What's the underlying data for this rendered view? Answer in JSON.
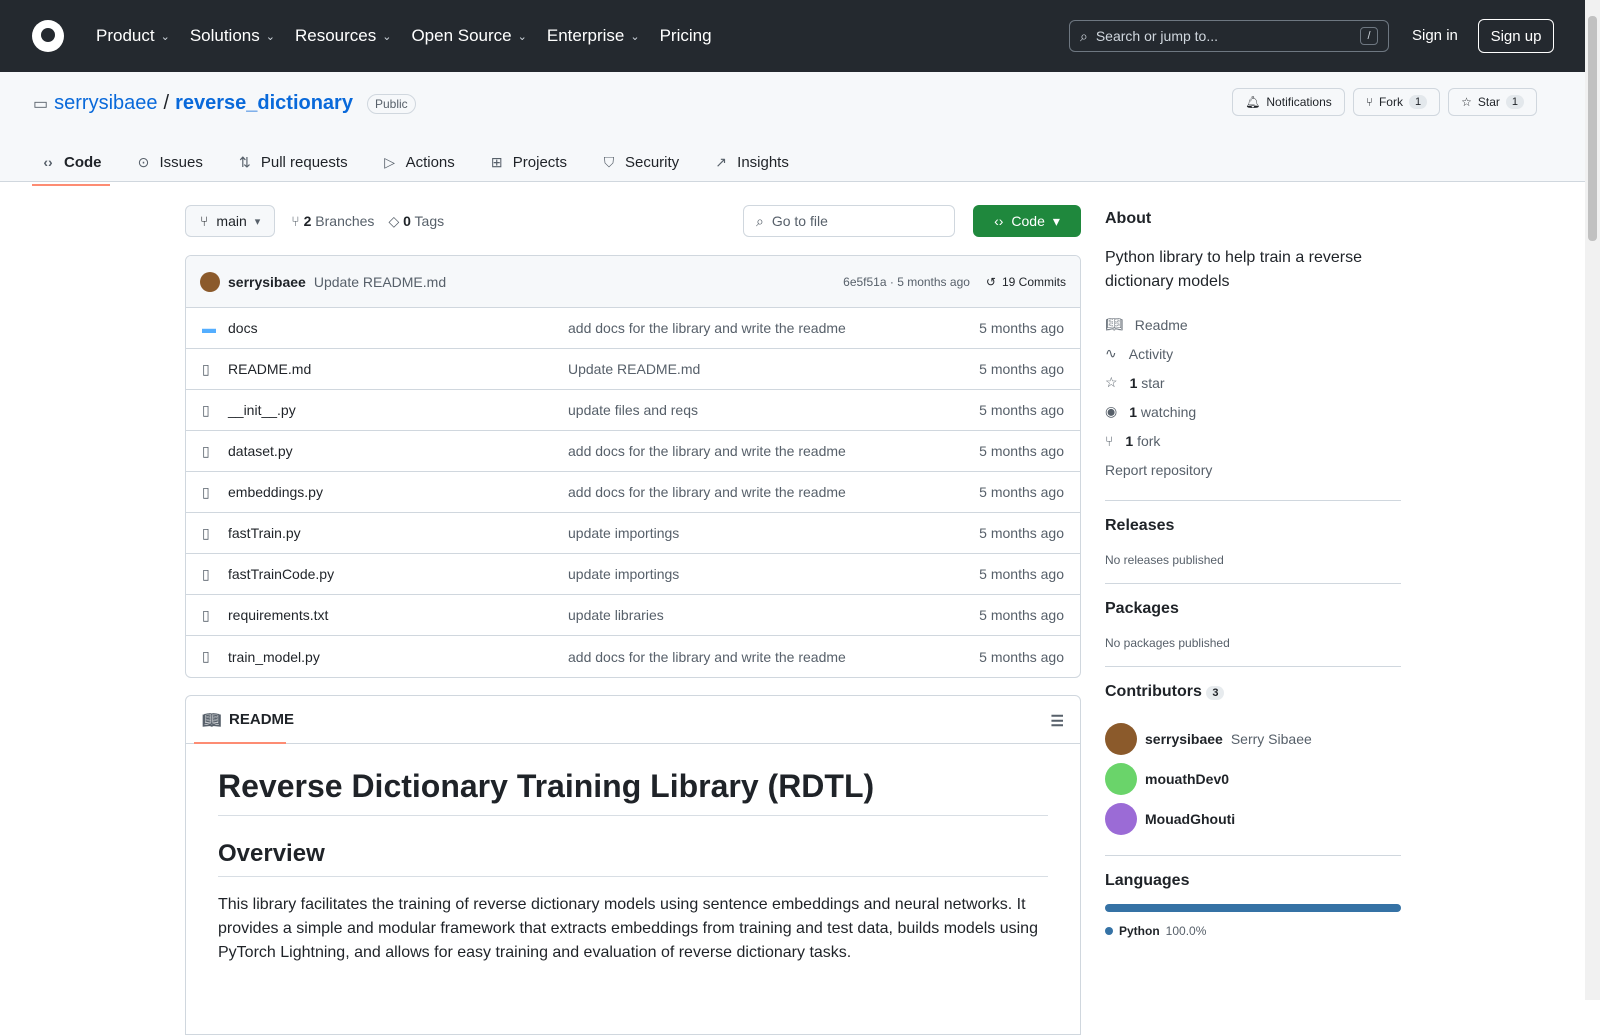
{
  "header": {
    "nav": [
      "Product",
      "Solutions",
      "Resources",
      "Open Source",
      "Enterprise",
      "Pricing"
    ],
    "search_placeholder": "Search or jump to...",
    "slash_key": "/",
    "sign_in": "Sign in",
    "sign_up": "Sign up"
  },
  "repo": {
    "owner": "serrysibaee",
    "separator": "/",
    "name": "reverse_dictionary",
    "visibility": "Public",
    "notifications": "Notifications",
    "fork_label": "Fork",
    "fork_count": "1",
    "star_label": "Star",
    "star_count": "1"
  },
  "tabs": [
    {
      "label": "Code",
      "icon": "code-icon"
    },
    {
      "label": "Issues",
      "icon": "issue-icon"
    },
    {
      "label": "Pull requests",
      "icon": "pull-request-icon"
    },
    {
      "label": "Actions",
      "icon": "play-icon"
    },
    {
      "label": "Projects",
      "icon": "table-icon"
    },
    {
      "label": "Security",
      "icon": "shield-icon"
    },
    {
      "label": "Insights",
      "icon": "graph-icon"
    }
  ],
  "toolbar": {
    "branch": "main",
    "branches_count": "2",
    "branches_label": "Branches",
    "tags_count": "0",
    "tags_label": "Tags",
    "goto_file": "Go to file",
    "code_button": "Code"
  },
  "latest_commit": {
    "author": "serrysibaee",
    "message": "Update README.md",
    "meta": "6e5f51a · 5 months ago",
    "commits": "19 Commits"
  },
  "files": [
    {
      "name": "docs",
      "type": "dir",
      "message": "add docs for the library and write the readme",
      "date": "5 months ago"
    },
    {
      "name": "README.md",
      "type": "file",
      "message": "Update README.md",
      "date": "5 months ago"
    },
    {
      "name": "__init__.py",
      "type": "file",
      "message": "update files and reqs",
      "date": "5 months ago"
    },
    {
      "name": "dataset.py",
      "type": "file",
      "message": "add docs for the library and write the readme",
      "date": "5 months ago"
    },
    {
      "name": "embeddings.py",
      "type": "file",
      "message": "add docs for the library and write the readme",
      "date": "5 months ago"
    },
    {
      "name": "fastTrain.py",
      "type": "file",
      "message": "update importings",
      "date": "5 months ago"
    },
    {
      "name": "fastTrainCode.py",
      "type": "file",
      "message": "update importings",
      "date": "5 months ago"
    },
    {
      "name": "requirements.txt",
      "type": "file",
      "message": "update libraries",
      "date": "5 months ago"
    },
    {
      "name": "train_model.py",
      "type": "file",
      "message": "add docs for the library and write the readme",
      "date": "5 months ago"
    }
  ],
  "readme": {
    "tab": "README",
    "h1": "Reverse Dictionary Training Library (RDTL)",
    "h2": "Overview",
    "p": "This library facilitates the training of reverse dictionary models using sentence embeddings and neural networks. It provides a simple and modular framework that extracts embeddings from training and test data, builds models using PyTorch Lightning, and allows for easy training and evaluation of reverse dictionary tasks."
  },
  "sidebar": {
    "about_title": "About",
    "about_desc": "Python library to help train a reverse dictionary models",
    "readme": "Readme",
    "activity": "Activity",
    "stars_count": "1",
    "stars_label": "star",
    "watching_count": "1",
    "watching_label": "watching",
    "forks_count": "1",
    "forks_label": "fork",
    "report": "Report repository",
    "releases_title": "Releases",
    "releases_note": "No releases published",
    "packages_title": "Packages",
    "packages_note": "No packages published",
    "contributors_title": "Contributors",
    "contributors_count": "3",
    "contributors": [
      {
        "login": "serrysibaee",
        "name": "Serry Sibaee"
      },
      {
        "login": "mouathDev0",
        "name": ""
      },
      {
        "login": "MouadGhouti",
        "name": ""
      }
    ],
    "languages_title": "Languages",
    "language": "Python",
    "language_pct": "100.0%",
    "language_color": "#3572a5"
  }
}
